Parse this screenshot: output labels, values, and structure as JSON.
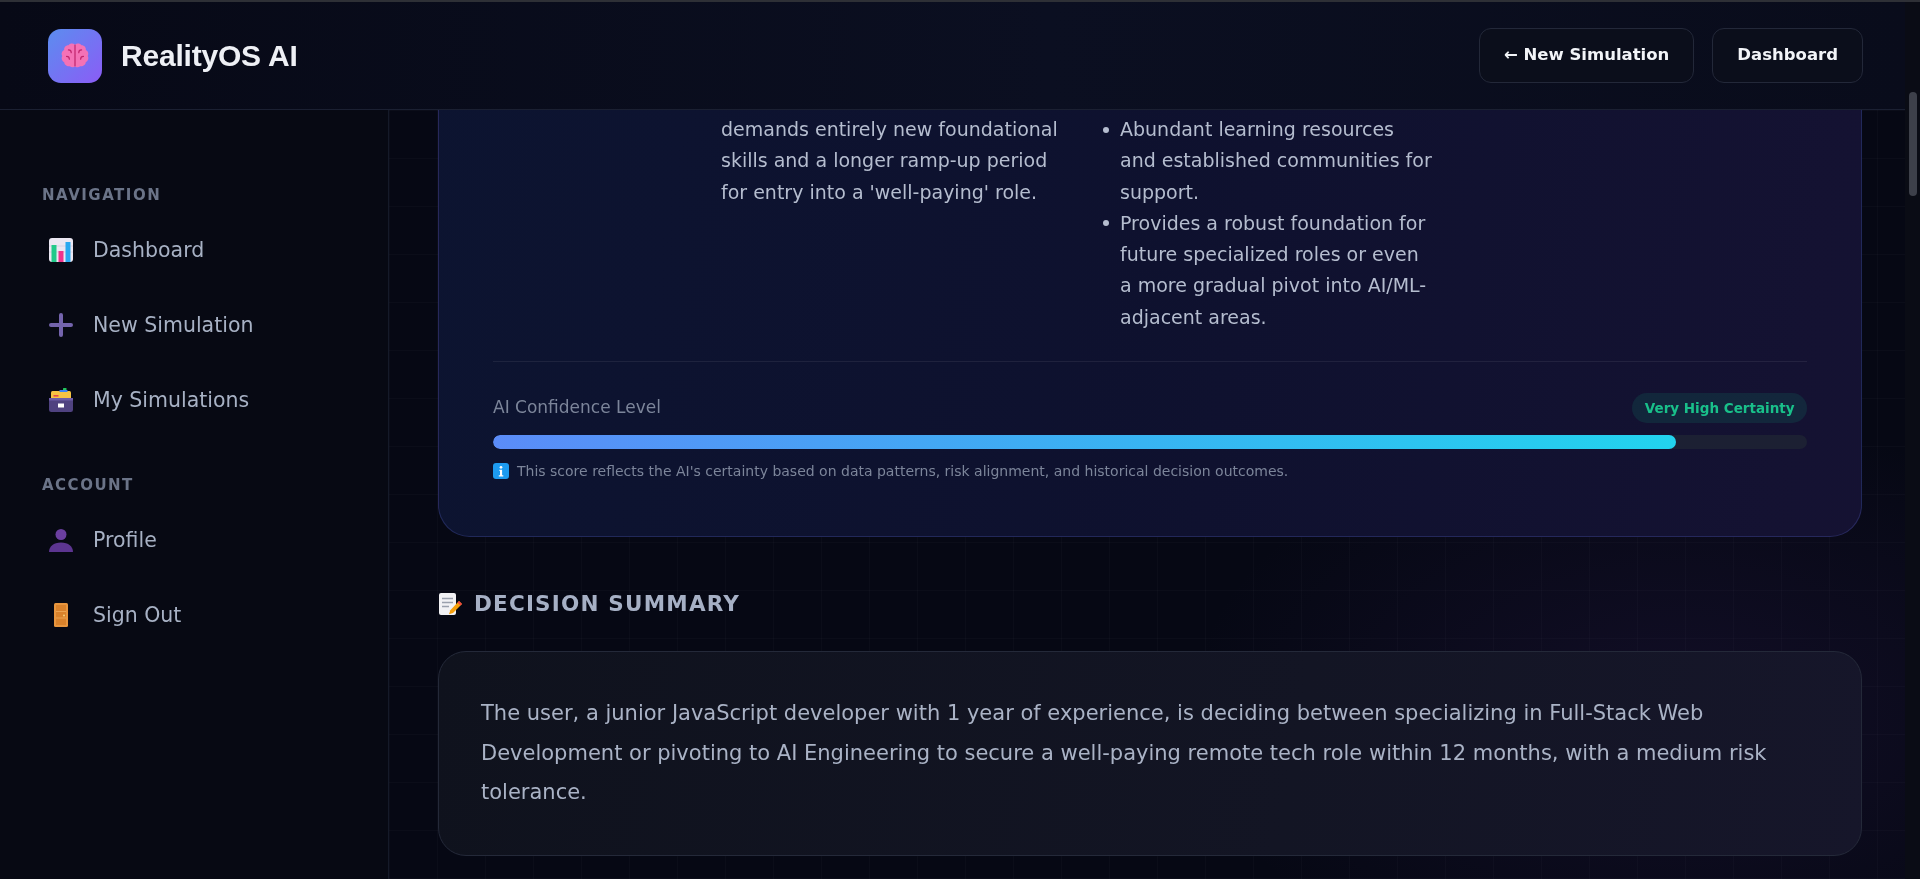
{
  "header": {
    "app_name": "RealityOS AI",
    "buttons": [
      {
        "label": "← New Simulation"
      },
      {
        "label": "Dashboard"
      }
    ]
  },
  "sidebar": {
    "sections": [
      {
        "title": "NAVIGATION",
        "items": [
          {
            "label": "Dashboard",
            "selected": false
          },
          {
            "label": "New Simulation",
            "selected": false
          },
          {
            "label": "My Simulations",
            "selected": false
          }
        ]
      },
      {
        "title": "ACCOUNT",
        "items": [
          {
            "label": "Profile",
            "selected": false
          },
          {
            "label": "Sign Out",
            "selected": false
          }
        ]
      }
    ]
  },
  "analysis_card": {
    "columns": [
      {
        "kind": "paragraph",
        "text": "demands entirely new foundational skills and a longer ramp-up period for entry into a 'well-paying' role."
      },
      {
        "kind": "bullets",
        "items": [
          "Abundant learning resources and established communities for support.",
          "Provides a robust foundation for future specialized roles or even a more gradual pivot into AI/ML-adjacent areas."
        ]
      }
    ],
    "confidence": {
      "label": "AI Confidence Level",
      "badge": "Very High Certainty",
      "level": 0.9,
      "note": "This score reflects the AI's certainty based on data patterns, risk alignment, and historical decision outcomes."
    }
  },
  "decision_summary": {
    "title": "DECISION SUMMARY",
    "text": "The user, a junior JavaScript developer with 1 year of experience, is deciding between specializing in Full-Stack Web Development or pivoting to AI Engineering to secure a well-paying remote tech role within 12 months, with a medium risk tolerance."
  }
}
